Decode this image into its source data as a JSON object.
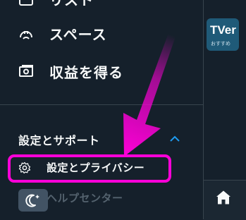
{
  "menu": {
    "items": [
      {
        "label": "リスト",
        "icon": "list-icon"
      },
      {
        "label": "スペース",
        "icon": "spaces-icon"
      },
      {
        "label": "収益を得る",
        "icon": "monetization-icon"
      }
    ],
    "section": {
      "label": "設定とサポート",
      "icon": "chevron-up-icon"
    },
    "sub_items": [
      {
        "label": "設定とプライバシー",
        "icon": "gear-icon",
        "highlighted": true
      },
      {
        "label": "ヘルプセンター",
        "icon": "help-icon"
      }
    ],
    "display_button_icon": "moon-sparkle-icon"
  },
  "right_panel": {
    "thumbnail": {
      "line1": "TVer",
      "line2": "おすすめ"
    },
    "bottom_nav_icon": "home-icon"
  },
  "annotation": {
    "color": "#ff00d8"
  }
}
